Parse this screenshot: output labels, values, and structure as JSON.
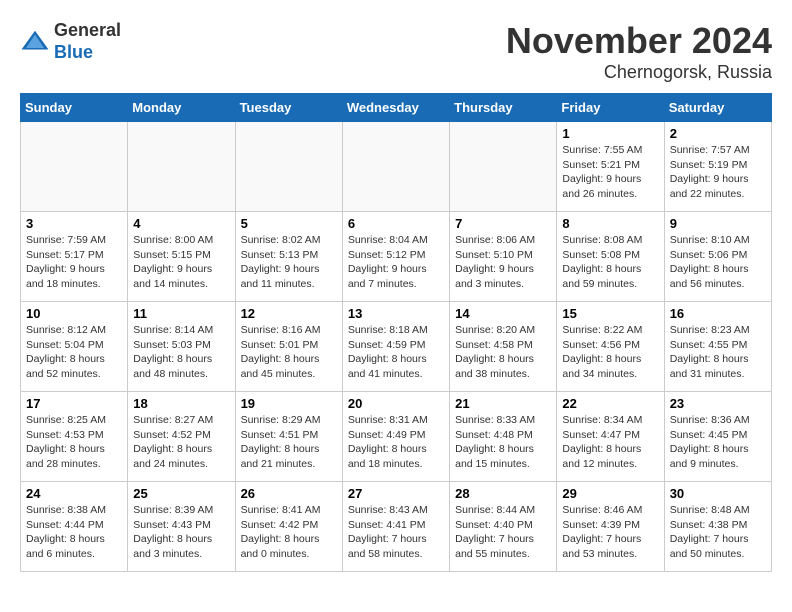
{
  "header": {
    "logo_line1": "General",
    "logo_line2": "Blue",
    "month_title": "November 2024",
    "location": "Chernogorsk, Russia"
  },
  "days_of_week": [
    "Sunday",
    "Monday",
    "Tuesday",
    "Wednesday",
    "Thursday",
    "Friday",
    "Saturday"
  ],
  "weeks": [
    [
      {
        "day": "",
        "info": ""
      },
      {
        "day": "",
        "info": ""
      },
      {
        "day": "",
        "info": ""
      },
      {
        "day": "",
        "info": ""
      },
      {
        "day": "",
        "info": ""
      },
      {
        "day": "1",
        "info": "Sunrise: 7:55 AM\nSunset: 5:21 PM\nDaylight: 9 hours\nand 26 minutes."
      },
      {
        "day": "2",
        "info": "Sunrise: 7:57 AM\nSunset: 5:19 PM\nDaylight: 9 hours\nand 22 minutes."
      }
    ],
    [
      {
        "day": "3",
        "info": "Sunrise: 7:59 AM\nSunset: 5:17 PM\nDaylight: 9 hours\nand 18 minutes."
      },
      {
        "day": "4",
        "info": "Sunrise: 8:00 AM\nSunset: 5:15 PM\nDaylight: 9 hours\nand 14 minutes."
      },
      {
        "day": "5",
        "info": "Sunrise: 8:02 AM\nSunset: 5:13 PM\nDaylight: 9 hours\nand 11 minutes."
      },
      {
        "day": "6",
        "info": "Sunrise: 8:04 AM\nSunset: 5:12 PM\nDaylight: 9 hours\nand 7 minutes."
      },
      {
        "day": "7",
        "info": "Sunrise: 8:06 AM\nSunset: 5:10 PM\nDaylight: 9 hours\nand 3 minutes."
      },
      {
        "day": "8",
        "info": "Sunrise: 8:08 AM\nSunset: 5:08 PM\nDaylight: 8 hours\nand 59 minutes."
      },
      {
        "day": "9",
        "info": "Sunrise: 8:10 AM\nSunset: 5:06 PM\nDaylight: 8 hours\nand 56 minutes."
      }
    ],
    [
      {
        "day": "10",
        "info": "Sunrise: 8:12 AM\nSunset: 5:04 PM\nDaylight: 8 hours\nand 52 minutes."
      },
      {
        "day": "11",
        "info": "Sunrise: 8:14 AM\nSunset: 5:03 PM\nDaylight: 8 hours\nand 48 minutes."
      },
      {
        "day": "12",
        "info": "Sunrise: 8:16 AM\nSunset: 5:01 PM\nDaylight: 8 hours\nand 45 minutes."
      },
      {
        "day": "13",
        "info": "Sunrise: 8:18 AM\nSunset: 4:59 PM\nDaylight: 8 hours\nand 41 minutes."
      },
      {
        "day": "14",
        "info": "Sunrise: 8:20 AM\nSunset: 4:58 PM\nDaylight: 8 hours\nand 38 minutes."
      },
      {
        "day": "15",
        "info": "Sunrise: 8:22 AM\nSunset: 4:56 PM\nDaylight: 8 hours\nand 34 minutes."
      },
      {
        "day": "16",
        "info": "Sunrise: 8:23 AM\nSunset: 4:55 PM\nDaylight: 8 hours\nand 31 minutes."
      }
    ],
    [
      {
        "day": "17",
        "info": "Sunrise: 8:25 AM\nSunset: 4:53 PM\nDaylight: 8 hours\nand 28 minutes."
      },
      {
        "day": "18",
        "info": "Sunrise: 8:27 AM\nSunset: 4:52 PM\nDaylight: 8 hours\nand 24 minutes."
      },
      {
        "day": "19",
        "info": "Sunrise: 8:29 AM\nSunset: 4:51 PM\nDaylight: 8 hours\nand 21 minutes."
      },
      {
        "day": "20",
        "info": "Sunrise: 8:31 AM\nSunset: 4:49 PM\nDaylight: 8 hours\nand 18 minutes."
      },
      {
        "day": "21",
        "info": "Sunrise: 8:33 AM\nSunset: 4:48 PM\nDaylight: 8 hours\nand 15 minutes."
      },
      {
        "day": "22",
        "info": "Sunrise: 8:34 AM\nSunset: 4:47 PM\nDaylight: 8 hours\nand 12 minutes."
      },
      {
        "day": "23",
        "info": "Sunrise: 8:36 AM\nSunset: 4:45 PM\nDaylight: 8 hours\nand 9 minutes."
      }
    ],
    [
      {
        "day": "24",
        "info": "Sunrise: 8:38 AM\nSunset: 4:44 PM\nDaylight: 8 hours\nand 6 minutes."
      },
      {
        "day": "25",
        "info": "Sunrise: 8:39 AM\nSunset: 4:43 PM\nDaylight: 8 hours\nand 3 minutes."
      },
      {
        "day": "26",
        "info": "Sunrise: 8:41 AM\nSunset: 4:42 PM\nDaylight: 8 hours\nand 0 minutes."
      },
      {
        "day": "27",
        "info": "Sunrise: 8:43 AM\nSunset: 4:41 PM\nDaylight: 7 hours\nand 58 minutes."
      },
      {
        "day": "28",
        "info": "Sunrise: 8:44 AM\nSunset: 4:40 PM\nDaylight: 7 hours\nand 55 minutes."
      },
      {
        "day": "29",
        "info": "Sunrise: 8:46 AM\nSunset: 4:39 PM\nDaylight: 7 hours\nand 53 minutes."
      },
      {
        "day": "30",
        "info": "Sunrise: 8:48 AM\nSunset: 4:38 PM\nDaylight: 7 hours\nand 50 minutes."
      }
    ]
  ]
}
